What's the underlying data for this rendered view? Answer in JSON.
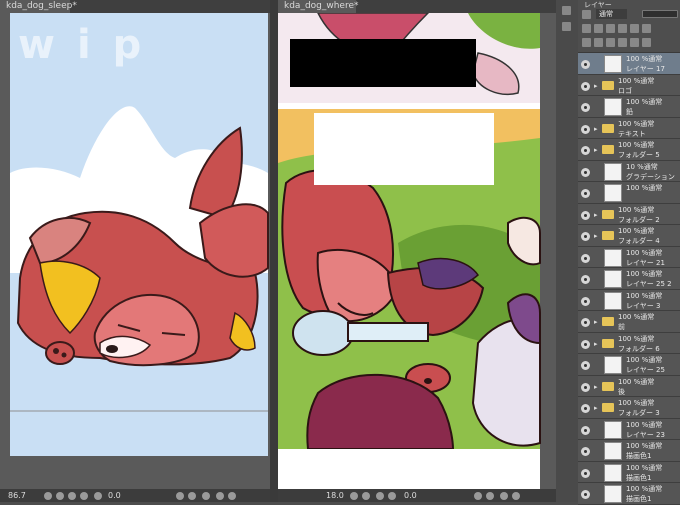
{
  "tabs": {
    "left": "kda_dog_sleep*",
    "right": "kda_dog_where*"
  },
  "left_canvas": {
    "watermark": "wip",
    "zoom": "86.7",
    "rotation": "0.0"
  },
  "right_canvas": {
    "zoom": "18.0",
    "rotation": "0.0"
  },
  "layer_panel": {
    "header_label": "レイヤー",
    "blend_mode": "通常",
    "layers": [
      {
        "mode": "100 %通常",
        "name": "レイヤー 17",
        "type": "layer",
        "selected": true
      },
      {
        "mode": "100 %通常",
        "name": "ロゴ",
        "type": "folder"
      },
      {
        "mode": "100 %通常",
        "name": "鉛",
        "type": "layer"
      },
      {
        "mode": "100 %通常",
        "name": "テキスト",
        "type": "folder"
      },
      {
        "mode": "100 %通常",
        "name": "フォルダー 5",
        "type": "folder"
      },
      {
        "mode": "10 %通常",
        "name": "グラデーション",
        "type": "layer"
      },
      {
        "mode": "100 %通常",
        "name": "",
        "type": "layer"
      },
      {
        "mode": "100 %通常",
        "name": "フォルダー 2",
        "type": "folder"
      },
      {
        "mode": "100 %通常",
        "name": "フォルダー 4",
        "type": "folder"
      },
      {
        "mode": "100 %通常",
        "name": "レイヤー 21",
        "type": "layer"
      },
      {
        "mode": "100 %通常",
        "name": "レイヤー 25 2",
        "type": "layer"
      },
      {
        "mode": "100 %通常",
        "name": "レイヤー 3",
        "type": "layer"
      },
      {
        "mode": "100 %通常",
        "name": "前",
        "type": "folder"
      },
      {
        "mode": "100 %通常",
        "name": "フォルダー 6",
        "type": "folder"
      },
      {
        "mode": "100 %通常",
        "name": "レイヤー 25",
        "type": "layer"
      },
      {
        "mode": "100 %通常",
        "name": "後",
        "type": "folder"
      },
      {
        "mode": "100 %通常",
        "name": "フォルダー 3",
        "type": "folder"
      },
      {
        "mode": "100 %通常",
        "name": "レイヤー 23",
        "type": "layer"
      },
      {
        "mode": "100 %通常",
        "name": "描画色1",
        "type": "layer"
      },
      {
        "mode": "100 %通常",
        "name": "描画色1",
        "type": "layer"
      },
      {
        "mode": "100 %通常",
        "name": "描画色1",
        "type": "layer"
      }
    ]
  }
}
